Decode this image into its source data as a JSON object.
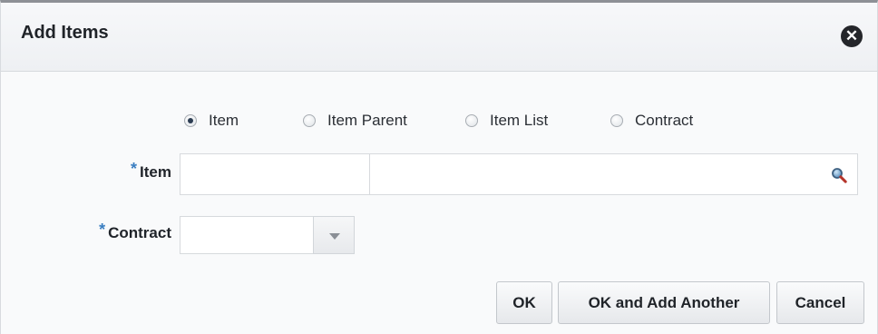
{
  "dialog": {
    "title": "Add Items",
    "close_icon": "close-circle-icon"
  },
  "radio_options": [
    {
      "label": "Item",
      "checked": true
    },
    {
      "label": "Item Parent",
      "checked": false
    },
    {
      "label": "Item List",
      "checked": false
    },
    {
      "label": "Contract",
      "checked": false
    }
  ],
  "fields": {
    "item": {
      "required_mark": "*",
      "label": "Item",
      "value": "",
      "description": "",
      "search_icon": "search-icon"
    },
    "contract": {
      "required_mark": "*",
      "label": "Contract",
      "value": "",
      "dropdown_icon": "chevron-down-icon"
    }
  },
  "buttons": {
    "ok": "OK",
    "ok_add_another": "OK and Add Another",
    "cancel": "Cancel"
  },
  "colors": {
    "required_accent": "#3a7ec1",
    "header_border": "#8d9096"
  }
}
